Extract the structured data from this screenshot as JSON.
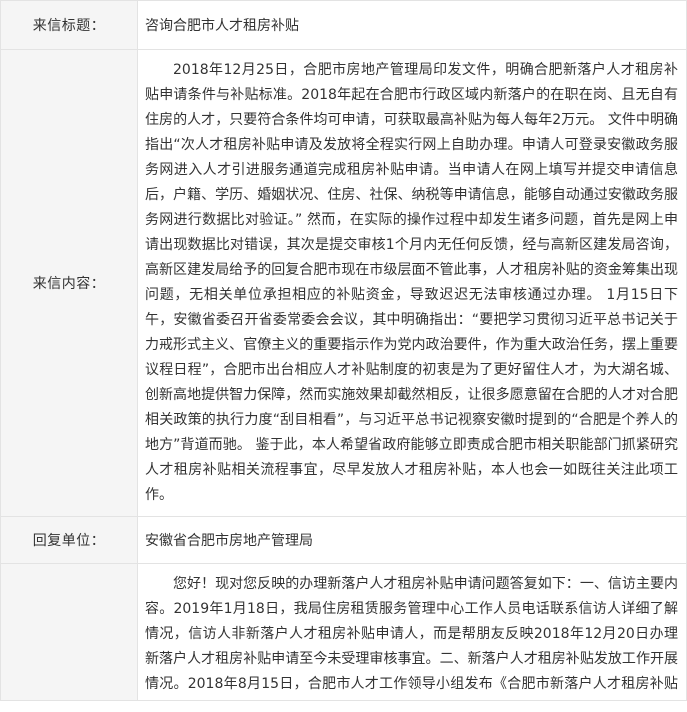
{
  "letter": {
    "title_label": "来信标题：",
    "title_value": "咨询合肥市人才租房补贴",
    "content_label": "来信内容：",
    "content_text": "2018年12月25日，合肥市房地产管理局印发文件，明确合肥新落户人才租房补贴申请条件与补贴标准。2018年起在合肥市行政区域内新落户的在职在岗、且无自有住房的人才，只要符合条件均可申请，可获取最高补贴为每人每年2万元。 文件中明确指出“次人才租房补贴申请及发放将全程实行网上自助办理。申请人可登录安徽政务服务网进入人才引进服务通道完成租房补贴申请。当申请人在网上填写并提交申请信息后，户籍、学历、婚姻状况、住房、社保、纳税等申请信息，能够自动通过安徽政务服务网进行数据比对验证。” 然而，在实际的操作过程中却发生诸多问题，首先是网上申请出现数据比对错误，其次是提交审核1个月内无任何反馈，经与高新区建发局咨询，高新区建发局给予的回复合肥市现在市级层面不管此事，人才租房补贴的资金筹集出现问题，无相关单位承担相应的补贴资金，导致迟迟无法审核通过办理。 1月15日下午，安徽省委召开省委常委会会议，其中明确指出：“要把学习贯彻习近平总书记关于力戒形式主义、官僚主义的重要指示作为党内政治要件，作为重大政治任务，摆上重要议程日程”，合肥市出台相应人才补贴制度的初衷是为了更好留住人才，为大湖名城、创新高地提供智力保障，然而实施效果却截然相反，让很多愿意留在合肥的人才对合肥相关政策的执行力度“刮目相看”，与习近平总书记视察安徽时提到的“合肥是个养人的地方”背道而驰。 鉴于此，本人希望省政府能够立即责成合肥市相关职能部门抓紧研究人才租房补贴相关流程事宜，尽早发放人才租房补贴，本人也会一如既往关注此项工作。",
    "unit_label": "回复单位：",
    "unit_value": "安徽省合肥市房地产管理局",
    "reply_text": "您好！现对您反映的办理新落户人才租房补贴申请问题答复如下：一、信访主要内容。2019年1月18日，我局住房租赁服务管理中心工作人员电话联系信访人详细了解情况，信访人非新落户人才租房补贴申请人，而是帮朋友反映2018年12月20日办理新落户人才租房补贴申请至今未受理审核事宜。二、新落户人才租房补贴发放工作开展情况。2018年8月15日，合肥市人才工作领导小组发布《合肥市新落户人才租房补贴发放"
  }
}
